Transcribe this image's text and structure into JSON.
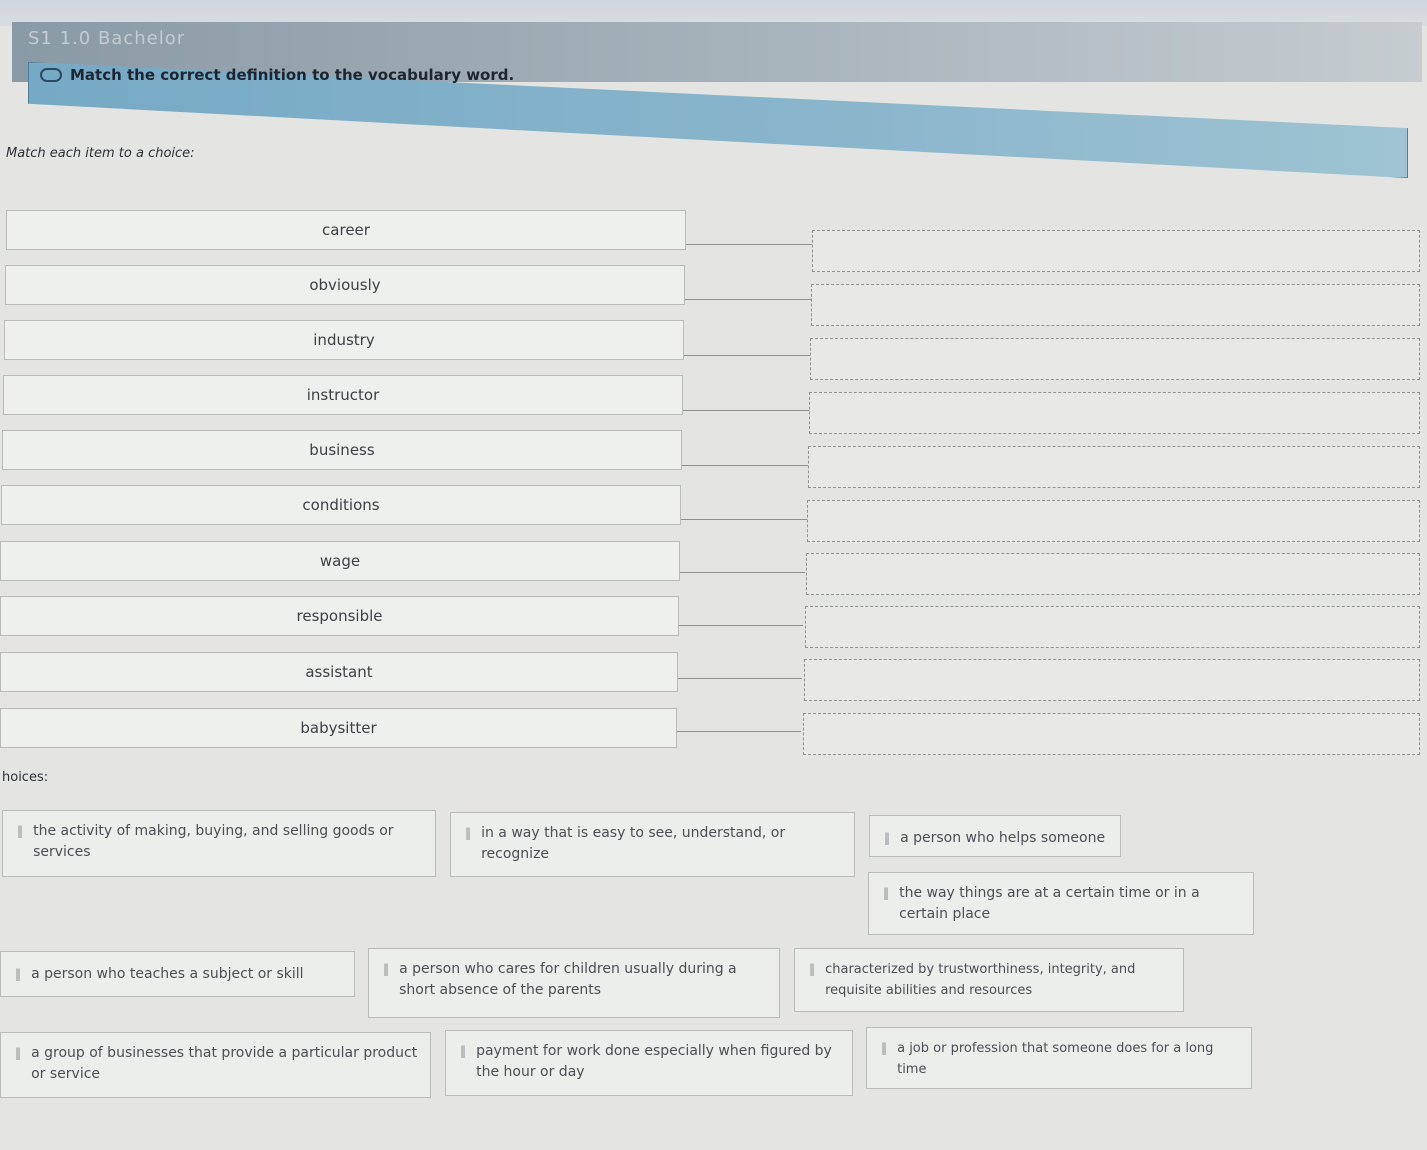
{
  "course": {
    "title": "S1 1.0 Bachelor"
  },
  "question": {
    "text": "Match the correct definition to the vocabulary word.",
    "icon": "question-icon",
    "instruction": "Match each item to a choice:"
  },
  "terms": [
    {
      "label": "career"
    },
    {
      "label": "obviously"
    },
    {
      "label": "industry"
    },
    {
      "label": "instructor"
    },
    {
      "label": "business"
    },
    {
      "label": "conditions"
    },
    {
      "label": "wage"
    },
    {
      "label": "responsible"
    },
    {
      "label": "assistant"
    },
    {
      "label": "babysitter"
    }
  ],
  "choices_label": "hoices:",
  "choices": [
    {
      "text": "the activity of making, buying, and selling goods or services"
    },
    {
      "text": "in a way that is easy to see, understand, or recognize"
    },
    {
      "text": "a person who helps someone"
    },
    {
      "text": "the way things are at a certain time or in a certain place"
    },
    {
      "text": "a person who teaches a subject or skill"
    },
    {
      "text": "a person who cares for children usually during a short absence of the parents"
    },
    {
      "text": "characterized by trustworthiness, integrity, and requisite abilities and resources"
    },
    {
      "text": "a group of businesses that provide a particular product or service"
    },
    {
      "text": "payment for work done especially when figured by the hour or day"
    },
    {
      "text": "a job or profession that someone does for a long time"
    }
  ],
  "icons": {
    "drag_handle": "grip-icon"
  }
}
